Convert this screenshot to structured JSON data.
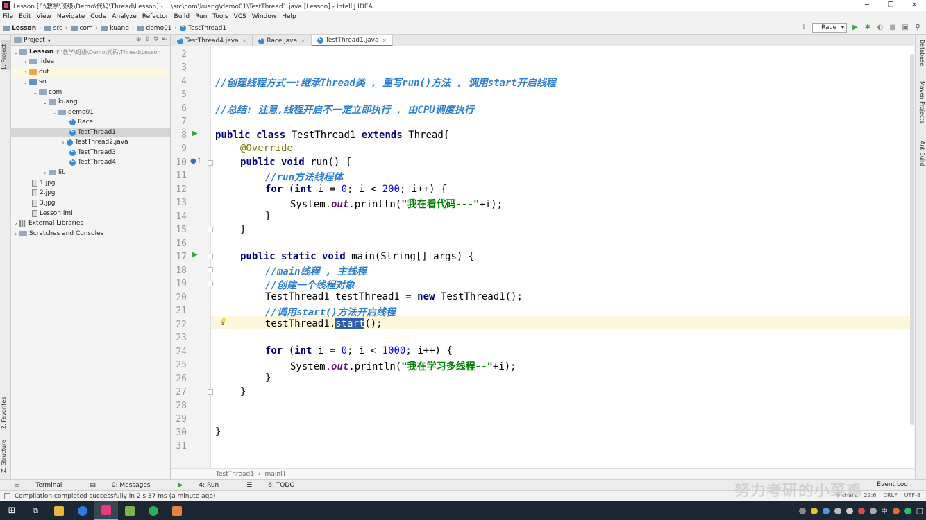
{
  "window": {
    "title": "Lesson [F:\\教学\\班级\\Demo\\代码\\Thread\\Lesson] - ...\\src\\com\\kuang\\demo01\\TestThread1.java [Lesson] - IntelliJ IDEA",
    "controls": [
      "─",
      "❐",
      "✕"
    ]
  },
  "menu": [
    "File",
    "Edit",
    "View",
    "Navigate",
    "Code",
    "Analyze",
    "Refactor",
    "Build",
    "Run",
    "Tools",
    "VCS",
    "Window",
    "Help"
  ],
  "navbar": {
    "crumbs": [
      "Lesson",
      "src",
      "com",
      "kuang",
      "demo01",
      "TestThread1"
    ],
    "run_config": "Race"
  },
  "left_stripe": {
    "project_tab": "1: Project",
    "favorites_tab": "2: Favorites",
    "structure_tab": "Z: Structure"
  },
  "right_stripe": {
    "database_tab": "Database",
    "maven_tab": "Maven Projects",
    "ant_tab": "Ant Build"
  },
  "project_panel": {
    "header": "Project",
    "tree": [
      {
        "label": "Lesson",
        "path": "F:\\教学\\班级\\Demo\\代码\\Thread\\Lesson"
      },
      {
        "label": ".idea"
      },
      {
        "label": "out"
      },
      {
        "label": "src"
      },
      {
        "label": "com"
      },
      {
        "label": "kuang"
      },
      {
        "label": "demo01"
      },
      {
        "label": "Race"
      },
      {
        "label": "TestThread1"
      },
      {
        "label": "TestThread2.java"
      },
      {
        "label": "TestThread3"
      },
      {
        "label": "TestThread4"
      },
      {
        "label": "lib"
      },
      {
        "label": "1.jpg"
      },
      {
        "label": "2.jpg"
      },
      {
        "label": "3.jpg"
      },
      {
        "label": "Lesson.iml"
      },
      {
        "label": "External Libraries"
      },
      {
        "label": "Scratches and Consoles"
      }
    ]
  },
  "editor_tabs": [
    {
      "label": "TestThread4.java"
    },
    {
      "label": "Race.java"
    },
    {
      "label": "TestThread1.java",
      "active": true
    }
  ],
  "editor": {
    "line_numbers": [
      "2",
      "3",
      "4",
      "5",
      "6",
      "7",
      "8",
      "9",
      "10",
      "11",
      "12",
      "13",
      "14",
      "15",
      "16",
      "17",
      "18",
      "19",
      "20",
      "21",
      "22",
      "23",
      "24",
      "25",
      "26",
      "27",
      "28",
      "29",
      "30",
      "31"
    ],
    "current_line": "22",
    "lines": {
      "l4": "//创建线程方式一:继承Thread类 , 重写run()方法 , 调用start开启线程",
      "l6": "//总结: 注意,线程开启不一定立即执行 , 由CPU调度执行",
      "l8_kw": "public class",
      "l8_name": "TestThread1",
      "l8_kw2": "extends",
      "l8_rest": "Thread{",
      "l9": "@Override",
      "l10_kw": "public void",
      "l10_rest": "run() {",
      "l11": "//run方法线程体",
      "l12_kw": "for",
      "l12_a": "(",
      "l12_kw2": "int",
      "l12_b": "i = ",
      "l12_n1": "0",
      "l12_c": "; i < ",
      "l12_n2": "200",
      "l12_d": "; i++) {",
      "l13_a": "System.",
      "l13_fld": "out",
      "l13_b": ".println(",
      "l13_str": "\"我在看代码---\"",
      "l13_c": "+i);",
      "l14": "}",
      "l15": "}",
      "l17_kw": "public static void",
      "l17_rest": "main(String[] args) {",
      "l18": "//main线程 , 主线程",
      "l19": "//创建一个线程对象",
      "l20_a": "TestThread1 testThread1 = ",
      "l20_kw": "new",
      "l20_b": "TestThread1();",
      "l21": "//调用start()方法开启线程",
      "l22_a": "testThread1.",
      "l22_sel": "start",
      "l22_b": "();",
      "l24_kw": "for",
      "l24_a": "(",
      "l24_kw2": "int",
      "l24_b": "i = ",
      "l24_n1": "0",
      "l24_c": "; i < ",
      "l24_n2": "1000",
      "l24_d": "; i++) {",
      "l25_a": "System.",
      "l25_fld": "out",
      "l25_b": ".println(",
      "l25_str": "\"我在学习多线程--\"",
      "l25_c": "+i);",
      "l26": "}",
      "l27": "}",
      "l30": "}"
    },
    "breadcrumb": [
      "TestThread1",
      "main()"
    ]
  },
  "bottom_tools": [
    "Terminal",
    "0: Messages",
    "4: Run",
    "6: TODO"
  ],
  "event_log": "Event Log",
  "status": {
    "message": "Compilation completed successfully in 2 s 37 ms (a minute ago)",
    "right": [
      "6 chars",
      "22:6",
      "CRLF",
      "UTF-8"
    ]
  },
  "watermark": "努力考研的小菜鸡",
  "taskbar": {
    "tray_text": "中"
  }
}
